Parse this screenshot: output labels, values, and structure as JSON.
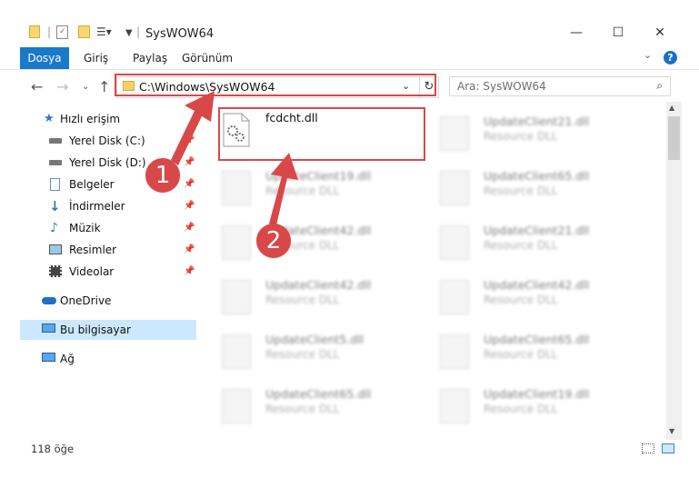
{
  "window": {
    "title": "SysWOW64",
    "minimize_glyph": "—",
    "maximize_glyph": "☐",
    "close_glyph": "✕"
  },
  "ribbon": {
    "tabs": [
      "Dosya",
      "Giriş",
      "Paylaş",
      "Görünüm"
    ],
    "active_tab": "Dosya",
    "active_color": "#1979ca"
  },
  "address": {
    "path": "C:\\Windows\\SysWOW64"
  },
  "search": {
    "placeholder": "Ara: SysWOW64"
  },
  "sidebar": {
    "items": [
      {
        "label": "Hızlı erişim",
        "icon": "star-icon",
        "pinned": false
      },
      {
        "label": "Yerel Disk (C:)",
        "icon": "drive-icon",
        "pinned": true
      },
      {
        "label": "Yerel Disk (D:)",
        "icon": "drive-icon",
        "pinned": true
      },
      {
        "label": "Belgeler",
        "icon": "documents-icon",
        "pinned": true
      },
      {
        "label": "İndirmeler",
        "icon": "download-icon",
        "pinned": true
      },
      {
        "label": "Müzik",
        "icon": "music-icon",
        "pinned": true
      },
      {
        "label": "Resimler",
        "icon": "pictures-icon",
        "pinned": true
      },
      {
        "label": "Videolar",
        "icon": "video-icon",
        "pinned": true
      },
      {
        "label": "OneDrive",
        "icon": "cloud-icon",
        "pinned": false
      },
      {
        "label": "Bu bilgisayar",
        "icon": "computer-icon",
        "pinned": false,
        "selected": true
      },
      {
        "label": "Ağ",
        "icon": "network-icon",
        "pinned": false
      }
    ]
  },
  "files": [
    {
      "name": "fcdcht.dll",
      "type": "",
      "highlighted": true
    },
    {
      "name": "UpdateClient21.dll",
      "type": "Resource DLL"
    },
    {
      "name": "UpdateClient19.dll",
      "type": "Resource DLL"
    },
    {
      "name": "UpdateClient65.dll",
      "type": "Resource DLL"
    },
    {
      "name": "UpdateClient42.dll",
      "type": "Resource DLL"
    },
    {
      "name": "UpdateClient21.dll",
      "type": "Resource DLL"
    },
    {
      "name": "UpdateClient42.dll",
      "type": "Resource DLL"
    },
    {
      "name": "UpdateClient42.dll",
      "type": "Resource DLL"
    },
    {
      "name": "UpdateClient5.dll",
      "type": "Resource DLL"
    },
    {
      "name": "UpdateClient65.dll",
      "type": "Resource DLL"
    },
    {
      "name": "UpdateClient65.dll",
      "type": "Resource DLL"
    },
    {
      "name": "UpdateClient19.dll",
      "type": "Resource DLL"
    }
  ],
  "status": {
    "item_count": "118 öğe"
  },
  "callouts": {
    "one": "1",
    "two": "2",
    "color": "#d94848"
  }
}
